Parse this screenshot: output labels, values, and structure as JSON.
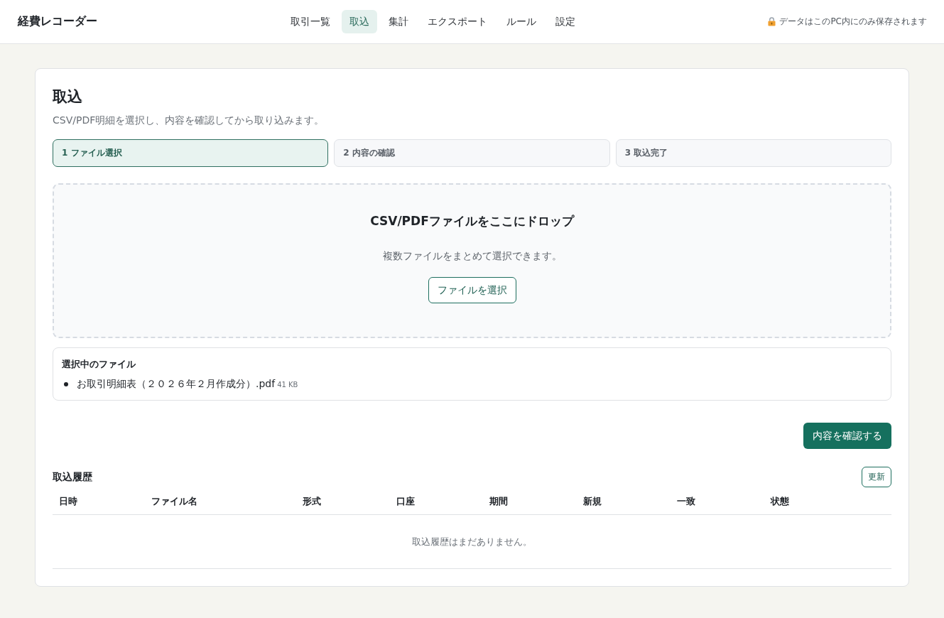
{
  "app": {
    "title": "経費レコーダー"
  },
  "nav": [
    {
      "label": "取引一覧",
      "selected": false
    },
    {
      "label": "取込",
      "selected": true
    },
    {
      "label": "集計",
      "selected": false
    },
    {
      "label": "エクスポート",
      "selected": false
    },
    {
      "label": "ルール",
      "selected": false
    },
    {
      "label": "設定",
      "selected": false
    }
  ],
  "privacy_note": "データはこのPC内にのみ保存されます",
  "page": {
    "title": "取込",
    "subtitle": "CSV/PDF明細を選択し、内容を確認してから取り込みます。"
  },
  "steps": [
    {
      "label": "1 ファイル選択",
      "selected": true
    },
    {
      "label": "2 内容の確認",
      "selected": false
    },
    {
      "label": "3 取込完了",
      "selected": false
    }
  ],
  "drop_zone": {
    "title": "CSV/PDFファイルをここにドロップ",
    "hint": "複数ファイルをまとめて選択できます。",
    "button": "ファイルを選択"
  },
  "selected_files": {
    "title": "選択中のファイル",
    "files": [
      {
        "name": "お取引明細表（２０２６年２月作成分）.pdf",
        "size": "41 KB"
      }
    ]
  },
  "confirm_button": "内容を確認する",
  "history": {
    "title": "取込履歴",
    "refresh_button": "更新",
    "columns": [
      "日時",
      "ファイル名",
      "形式",
      "口座",
      "期間",
      "新規",
      "一致",
      "状態"
    ],
    "empty_message": "取込履歴はまだありません。"
  }
}
